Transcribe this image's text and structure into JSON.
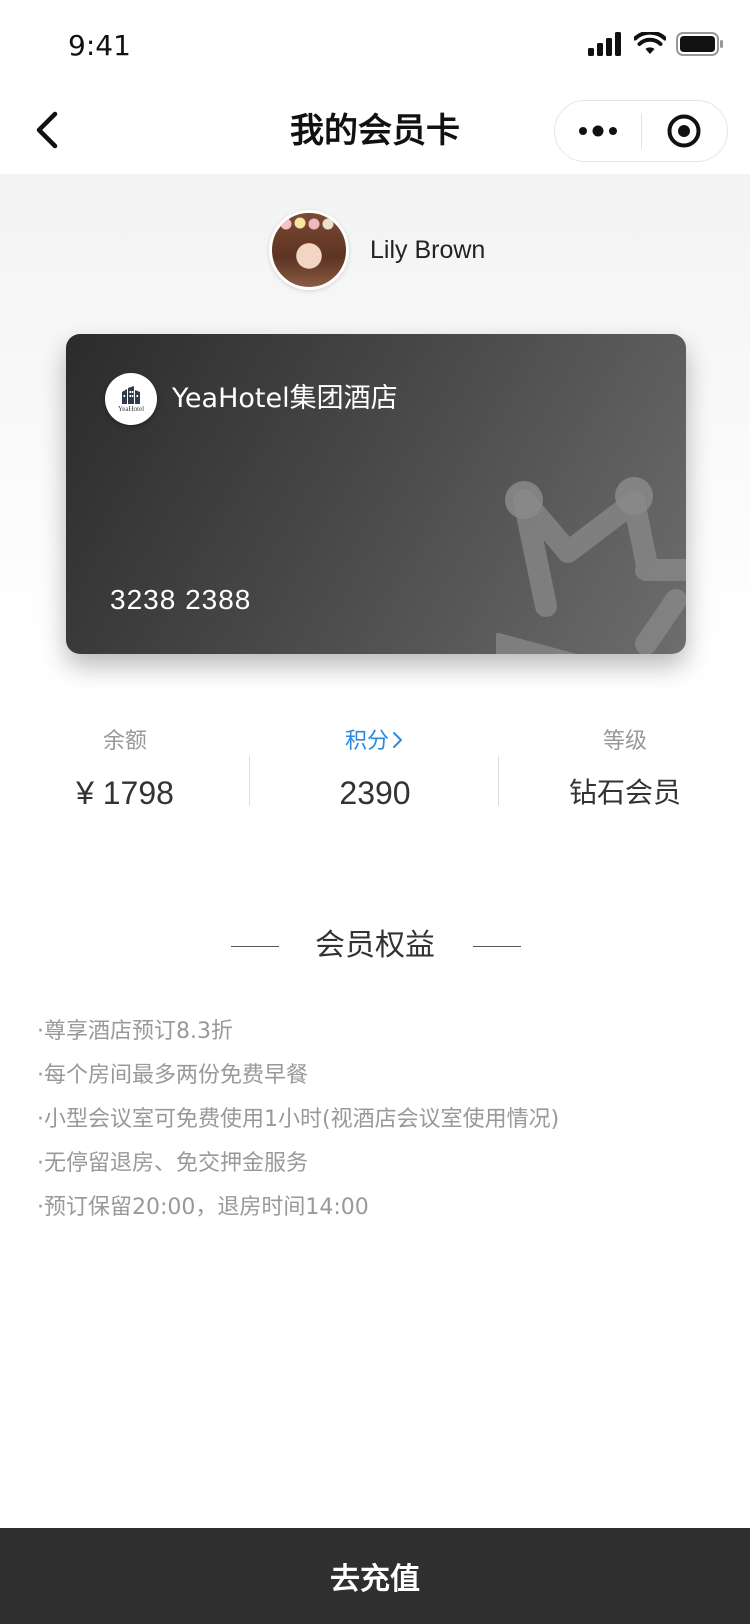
{
  "status_bar": {
    "time": "9:41",
    "icons": [
      "signal-icon",
      "wifi-icon",
      "battery-icon"
    ]
  },
  "nav": {
    "title": "我的会员卡",
    "back_icon": "chevron-left-icon",
    "menu_icon": "more-dots-icon",
    "close_icon": "target-close-icon"
  },
  "profile": {
    "name": "Lily Brown"
  },
  "card": {
    "hotel_name": "YeaHotel集团酒店",
    "logo_text": "YeaHotel",
    "number": "3238 2388",
    "watermark_icon": "crown-icon"
  },
  "stats": {
    "balance_label": "余额",
    "balance_value": "¥ 1798",
    "points_label": "积分",
    "points_value": "2390",
    "level_label": "等级",
    "level_value": "钻石会员"
  },
  "benefits": {
    "title": "会员权益",
    "items": [
      "·尊享酒店预订8.3折",
      "·每个房间最多两份免费早餐",
      "·小型会议室可免费使用1小时(视酒店会议室使用情况)",
      "·无停留退房、免交押金服务",
      "·预订保留20:00，退房时间14:00"
    ]
  },
  "action": {
    "recharge_label": "去充值"
  },
  "colors": {
    "accent_link": "#2a8ae0",
    "card_dark": "#2b2b2b",
    "button_bg": "#2f2f2f"
  }
}
